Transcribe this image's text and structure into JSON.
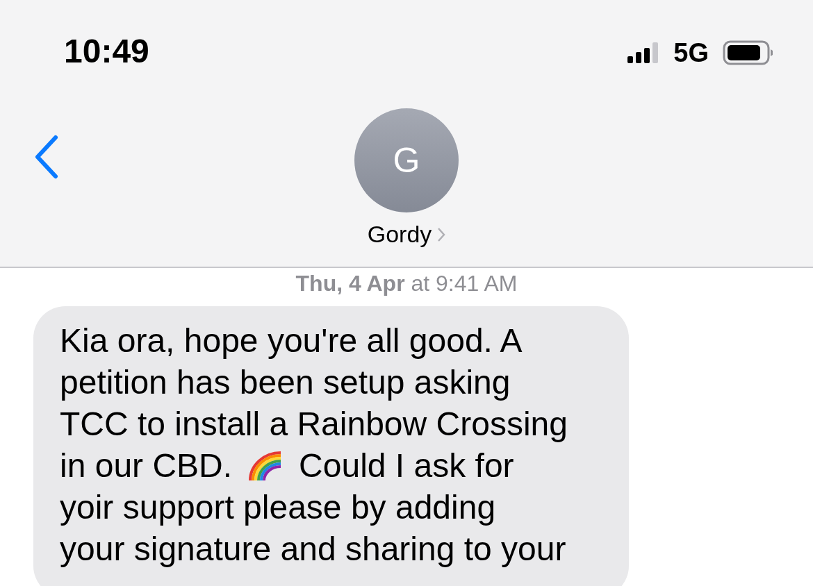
{
  "status_bar": {
    "time": "10:49",
    "network": "5G"
  },
  "header": {
    "avatar_initial": "G",
    "contact_name": "Gordy"
  },
  "timestamp": "**Thu, 4 Apr** at 9:41 AM",
  "message": {
    "lines": [
      [
        {
          "kind": "text",
          "text": "Kia ora, hope you're all good. A"
        }
      ],
      [
        {
          "kind": "text",
          "text": "petition has been setup asking"
        }
      ],
      [
        {
          "kind": "text",
          "text": "TCC to install a Rainbow Crossing"
        }
      ],
      [
        {
          "kind": "text",
          "text": "in our CBD."
        },
        {
          "kind": "rainbow"
        },
        {
          "kind": "text",
          "text": "Could I ask for"
        }
      ],
      [
        {
          "kind": "text",
          "text": "yoir support please by adding"
        }
      ],
      [
        {
          "kind": "text",
          "text": "your signature and sharing to your"
        }
      ]
    ]
  }
}
